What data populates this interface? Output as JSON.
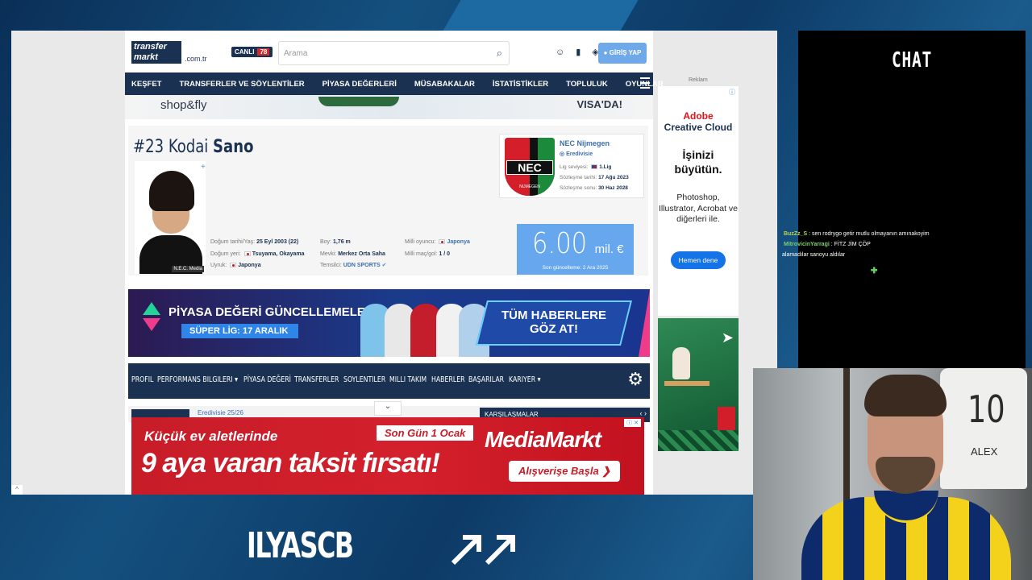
{
  "header": {
    "logo_line1": "transfer",
    "logo_line2": "markt",
    "logo_domain": ".com.tr",
    "live_label": "CANLI",
    "live_count": "78",
    "search_placeholder": "Arama",
    "login_label": "GİRİŞ YAP"
  },
  "nav": [
    "KEŞFET",
    "TRANSFERLER VE SÖYLENTİLER",
    "PİYASA DEĞERLERİ",
    "MÜSABAKALAR",
    "İSTATİSTİKLER",
    "TOPLULUK",
    "OYUNLAR"
  ],
  "top_ad": {
    "left": "shop&fly",
    "right": "VISA'DA!"
  },
  "player": {
    "number": "#23",
    "first_name": "Kodai",
    "last_name": "Sano",
    "photo_caption": "N.E.C. Media",
    "birth_label": "Doğum tarihi/Yaş:",
    "birth_value": "25 Eyl 2003 (22)",
    "birthplace_label": "Doğum yeri:",
    "birthplace_value": "Tsuyama, Okayama",
    "citizenship_label": "Uyruk:",
    "citizenship_value": "Japonya",
    "height_label": "Boy:",
    "height_value": "1,76 m",
    "position_label": "Mevki:",
    "position_value": "Merkez Orta Saha",
    "agent_label": "Temsilci:",
    "agent_value": "UDN SPORTS",
    "national_label": "Milli oyuncu:",
    "national_value": "Japonya",
    "caps_label": "Milli maç/gol:",
    "caps_value": "1 / 0"
  },
  "club": {
    "crest_text": "NEC",
    "crest_subtext": "NIJMEGEN",
    "name": "NEC Nijmegen",
    "league": "Eredivisie",
    "level_label": "Lig seviyesi:",
    "level_value": "1.Lig",
    "signed_label": "Sözleşme tarihi:",
    "signed_value": "17 Ağu 2023",
    "expires_label": "Sözleşme sonu:",
    "expires_value": "30 Haz 2028"
  },
  "market_value": {
    "amount": "6.00",
    "unit": "mil. €",
    "updated": "Son güncelleme: 2 Ara 2025"
  },
  "banner": {
    "title": "PİYASA DEĞERİ GÜNCELLEMELERİ",
    "subtitle": "SÜPER LİG: 17 ARALIK",
    "cta_line1": "TÜM HABERLERE",
    "cta_line2": "GÖZ AT!"
  },
  "subnav": [
    "PROFİL",
    "PERFORMANS BİLGİLERİ ▾",
    "PİYASA DEĞERİ",
    "TRANSFERLER",
    "SÖYLENTİLER",
    "MİLLİ TAKIM",
    "HABERLER",
    "BAŞARILAR",
    "KARİYER ▾"
  ],
  "strip": {
    "season": "Eredivisie 25/26",
    "matches": "KARŞILAŞMALAR"
  },
  "mediamarkt_ad": {
    "line1": "Küçük ev aletlerinde",
    "line2": "9 aya varan taksit fırsatı!",
    "badge": "Son Gün 1 Ocak",
    "brand": "MediaMarkt",
    "cta": "Alışverişe Başla"
  },
  "side_ad": {
    "reklam": "Reklam",
    "brand1": "Adobe",
    "brand2": "Creative Cloud",
    "headline": "İşinizi büyütün.",
    "products": "Photoshop, Illustrator, Acrobat ve diğerleri ile.",
    "button": "Hemen dene"
  },
  "chat": {
    "title": "CHAT",
    "messages": [
      {
        "user": "BuzZz_S",
        "text": "sen rodrygo getir mutlu olmayanın amınakoyim"
      },
      {
        "user": "MitrovicinYarragi",
        "text": "FİTZ JİM ÇÖP"
      },
      {
        "user": "",
        "text": "alamadılar sanoyu aldılar"
      }
    ]
  },
  "webcam": {
    "jersey_number": "10",
    "jersey_name": "ALEX"
  },
  "branding": {
    "streamer": "ILYASCB"
  }
}
